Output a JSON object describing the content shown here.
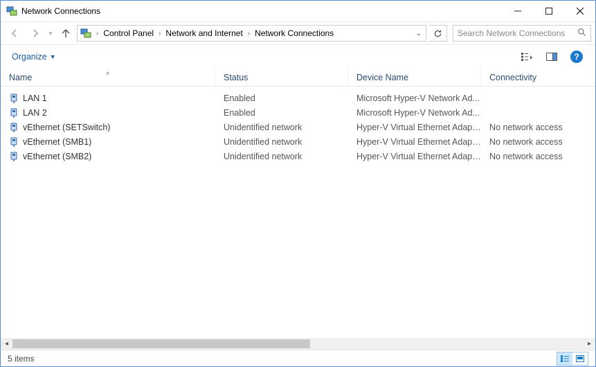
{
  "window": {
    "title": "Network Connections"
  },
  "breadcrumb": {
    "seg1": "Control Panel",
    "seg2": "Network and Internet",
    "seg3": "Network Connections"
  },
  "search": {
    "placeholder": "Search Network Connections"
  },
  "toolbar": {
    "organize": "Organize"
  },
  "columns": {
    "name": "Name",
    "status": "Status",
    "device": "Device Name",
    "conn": "Connectivity"
  },
  "rows": [
    {
      "name": "LAN 1",
      "status": "Enabled",
      "device": "Microsoft Hyper-V Network Ad...",
      "conn": ""
    },
    {
      "name": "LAN 2",
      "status": "Enabled",
      "device": "Microsoft Hyper-V Network Ad...",
      "conn": ""
    },
    {
      "name": "vEthernet (SETSwitch)",
      "status": "Unidentified network",
      "device": "Hyper-V Virtual Ethernet Adapter",
      "conn": "No network access"
    },
    {
      "name": "vEthernet (SMB1)",
      "status": "Unidentified network",
      "device": "Hyper-V Virtual Ethernet Adapte...",
      "conn": "No network access"
    },
    {
      "name": "vEthernet (SMB2)",
      "status": "Unidentified network",
      "device": "Hyper-V Virtual Ethernet Adapte...",
      "conn": "No network access"
    }
  ],
  "statusbar": {
    "text": "5 items"
  }
}
